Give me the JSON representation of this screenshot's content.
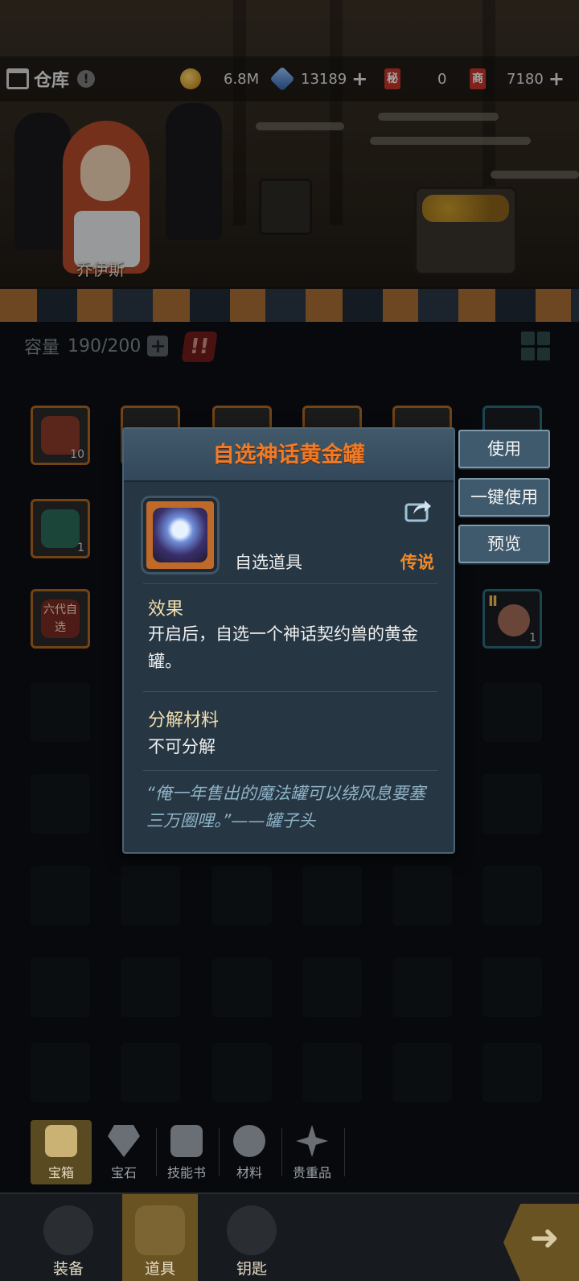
{
  "topbar": {
    "title": "仓库",
    "info_icon": "!",
    "gold": "6.8M",
    "gems": "13189",
    "ticket_a_icon_text": "秘",
    "ticket_a_value": "0",
    "ticket_b_icon_text": "商",
    "ticket_b_value": "7180"
  },
  "hero": {
    "name": "乔伊斯"
  },
  "capacity": {
    "label": "容量",
    "value": "190/200"
  },
  "slots": {
    "slot1_count": "10",
    "slot2_count": "1",
    "slot3_label": "六代自选",
    "slot_right_count": "1",
    "slot_right_tier": "Ⅱ"
  },
  "popup": {
    "title": "自选神话黄金罐",
    "item_type": "自选道具",
    "rarity": "传说",
    "effect_title": "效果",
    "effect_text": "开启后，自选一个神话契约兽的黄金罐。",
    "decompose_title": "分解材料",
    "decompose_text": "不可分解",
    "quote": "“俺一年售出的魔法罐可以绕风息要塞三万圈哩。”——罐子头"
  },
  "actions": {
    "use": "使用",
    "use_all": "一键使用",
    "preview": "预览"
  },
  "categories": [
    {
      "label": "宝箱",
      "icon": "chest-icon",
      "active": true
    },
    {
      "label": "宝石",
      "icon": "gem-icon",
      "active": false
    },
    {
      "label": "技能书",
      "icon": "book-icon",
      "active": false
    },
    {
      "label": "材料",
      "icon": "material-icon",
      "active": false
    },
    {
      "label": "贵重品",
      "icon": "valuable-icon",
      "active": false
    }
  ],
  "nav": [
    {
      "label": "装备",
      "icon": "equipment-icon",
      "active": false
    },
    {
      "label": "道具",
      "icon": "item-icon",
      "active": true
    },
    {
      "label": "钥匙",
      "icon": "key-icon",
      "active": false
    }
  ],
  "colors": {
    "popup_title": "#f07a26",
    "rarity_legendary": "#f08a2a",
    "section_title": "#f3dfae",
    "quote": "#8fb3c8"
  }
}
